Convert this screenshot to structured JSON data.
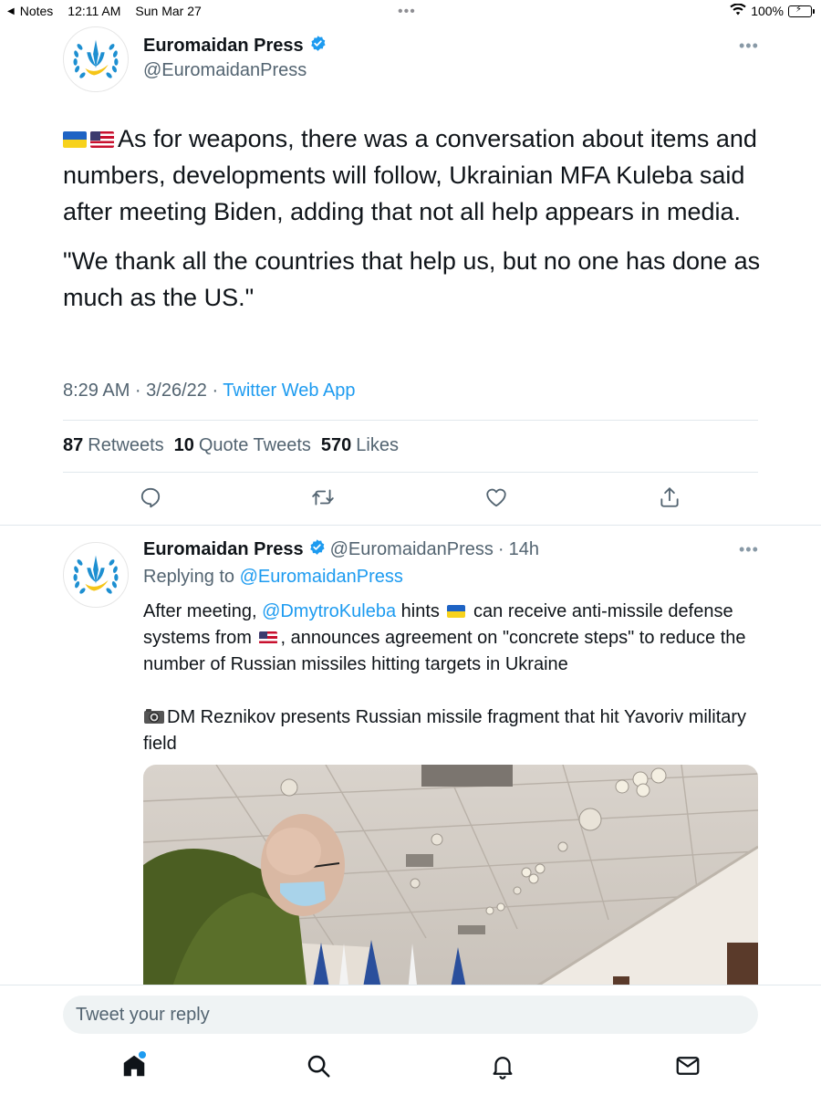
{
  "status_bar": {
    "back_app": "Notes",
    "time": "12:11 AM",
    "date": "Sun Mar 27",
    "battery": "100%",
    "dots": "•••"
  },
  "main_tweet": {
    "display_name": "Euromaidan Press",
    "handle": "@EuromaidanPress",
    "more": "•••",
    "paragraph_1": "As for weapons, there was a conversation about items and numbers, developments will follow, Ukrainian MFA Kuleba said after meeting Biden, adding that not all help appears in media.",
    "paragraph_2": "\"We thank all the countries that help us, but no one has done as much as the US.\"",
    "time": "8:29 AM · 3/26/22 · ",
    "source": "Twitter Web App",
    "stats": {
      "retweets_count": "87",
      "retweets_label": "Retweets",
      "quotes_count": "10",
      "quotes_label": "Quote Tweets",
      "likes_count": "570",
      "likes_label": "Likes"
    },
    "actions": [
      "reply-icon",
      "retweet-icon",
      "like-icon",
      "share-icon"
    ]
  },
  "reply_tweet": {
    "display_name": "Euromaidan Press",
    "handle": "@EuromaidanPress",
    "separator": "·",
    "age": "14h",
    "more": "•••",
    "replying_prefix": "Replying to ",
    "replying_to": "@EuromaidanPress",
    "line1_a": "After meeting, ",
    "mention": "@DmytroKuleba",
    "line1_b": " hints ",
    "line1_c": " can receive anti-missile defense systems from ",
    "line1_d": ", announces agreement on \"concrete steps\" to reduce the number of Russian missiles hitting targets in Ukraine",
    "paragraph_2": "DM Reznikov presents Russian missile fragment that hit Yavoriv military field"
  },
  "reply_bar": {
    "placeholder": "Tweet your reply"
  },
  "tab_bar": {
    "items": [
      "home-icon",
      "search-icon",
      "notifications-icon",
      "messages-icon"
    ]
  },
  "colors": {
    "accent": "#1d9bf0",
    "text": "#0f1419",
    "secondary": "#536471"
  }
}
